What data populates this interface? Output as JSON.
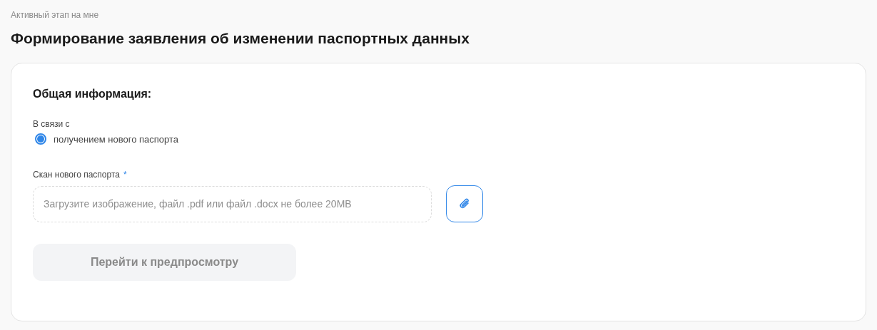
{
  "header": {
    "caption": "Активный этап на мне",
    "title": "Формирование заявления об изменении паспортных данных"
  },
  "form": {
    "section_title": "Общая информация:",
    "reason": {
      "label": "В связи с",
      "options": [
        {
          "label": "получением нового паспорта",
          "selected": true
        }
      ]
    },
    "upload": {
      "label": "Скан нового паспорта",
      "required_mark": "*",
      "placeholder": "Загрузите изображение, файл .pdf или файл .docx не более 20MB"
    },
    "submit": {
      "label": "Перейти к предпросмотру",
      "disabled": true
    }
  }
}
